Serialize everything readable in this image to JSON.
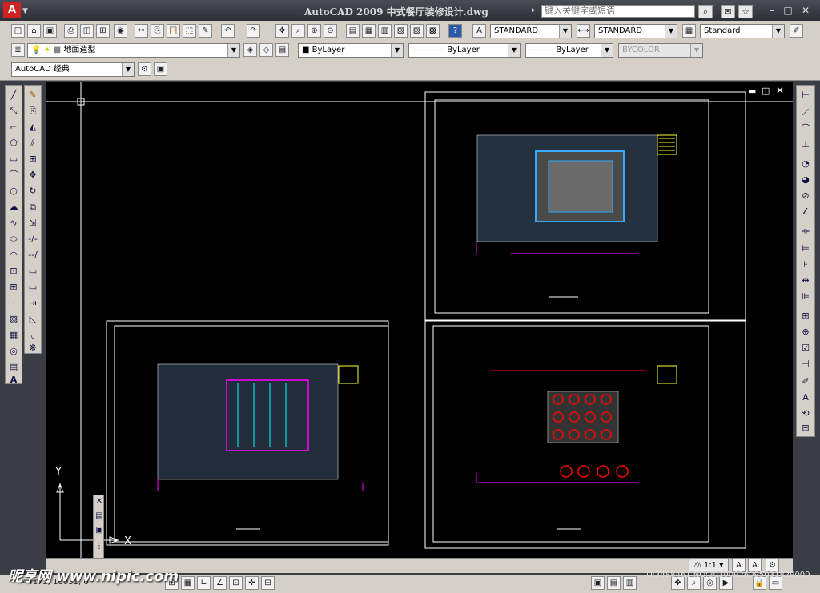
{
  "titlebar": {
    "title": "AutoCAD 2009  中式餐厅装修设计.dwg",
    "search_placeholder": "键入关键字或短语"
  },
  "layers": {
    "current_layer": "地面造型",
    "color": "ByLayer",
    "linetype": "ByLayer",
    "lineweight": "ByLayer",
    "plotstyle": "BYCOLOR"
  },
  "styles": {
    "text_style": "STANDARD",
    "dim_style": "STANDARD",
    "table_style": "Standard"
  },
  "workspace": {
    "name": "AutoCAD 经典"
  },
  "status": {
    "scale": "1:1",
    "coords": "44172, 10031, 0"
  },
  "watermark": {
    "brand": "昵享网 www.nipic.com",
    "id_text": "ID:3488461 NO:20100926095031829000"
  },
  "ucs": {
    "x_label": "X",
    "y_label": "Y"
  }
}
